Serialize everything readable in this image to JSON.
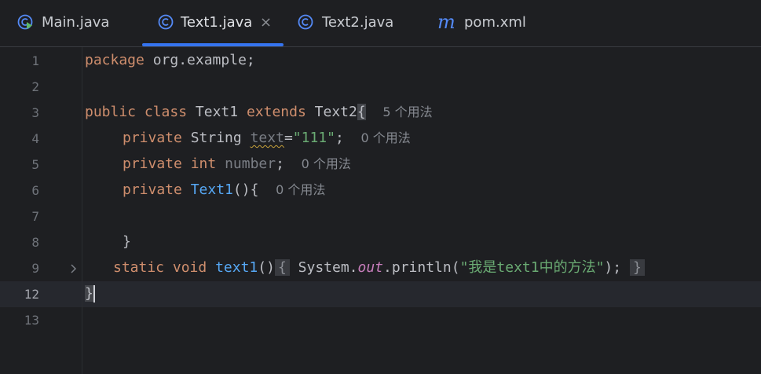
{
  "tabs": [
    {
      "label": "Main.java",
      "icon": "run-class-icon",
      "active": false
    },
    {
      "label": "Text1.java",
      "icon": "class-icon",
      "active": true,
      "close": "×"
    },
    {
      "label": "Text2.java",
      "icon": "class-icon",
      "active": false
    },
    {
      "label": "pom.xml",
      "icon": "maven-icon",
      "icon_glyph": "m",
      "active": false
    }
  ],
  "editor": {
    "line_numbers": [
      "1",
      "2",
      "3",
      "4",
      "5",
      "6",
      "7",
      "8",
      "9",
      "12",
      "13"
    ],
    "current_line": "12",
    "lines": {
      "l1": {
        "kw": "package",
        "rest": " org.example;"
      },
      "l3": {
        "kw1": "public",
        "kw2": "class",
        "name": "Text1",
        "kw3": "extends",
        "parent": "Text2",
        "brace": "{",
        "hint": "5 个用法"
      },
      "l4": {
        "kw": "private",
        "type": "String",
        "field": "text",
        "eq": "=",
        "value": "\"111\"",
        "semi": ";",
        "hint": "0 个用法"
      },
      "l5": {
        "kw": "private",
        "type": "int",
        "field": "number",
        "semi": ";",
        "hint": "0 个用法"
      },
      "l6": {
        "kw": "private",
        "name": "Text1",
        "rest": "(){",
        "hint": "0 个用法"
      },
      "l8": {
        "brace": "}"
      },
      "l9": {
        "kw1": "static",
        "kw2": "void",
        "name": "text1",
        "parens": "()",
        "open": "{",
        "sys": "System.",
        "out": "out",
        "call": ".println(",
        "str": "\"我是text1中的方法\"",
        "end": ");",
        "close": "}"
      },
      "l12": {
        "brace": "}"
      }
    }
  },
  "colors": {
    "background": "#1e1f22",
    "keyword": "#cf8e6d",
    "class_name": "#56a8f5",
    "string": "#6aab73",
    "tab_underline": "#3574f0"
  }
}
